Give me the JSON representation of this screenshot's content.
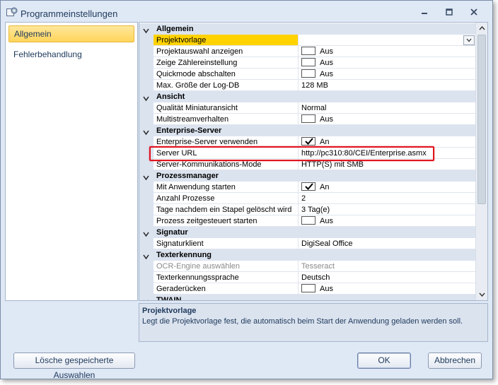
{
  "window": {
    "title": "Programmeinstellungen",
    "icon": "settings-gear-icon"
  },
  "nav": {
    "items": [
      {
        "label": "Allgemein",
        "selected": true
      },
      {
        "label": "Fehlerbehandlung",
        "selected": false
      }
    ]
  },
  "grid": {
    "categories": {
      "allgemein": "Allgemein",
      "ansicht": "Ansicht",
      "enterprise": "Enterprise-Server",
      "prozess": "Prozessmanager",
      "signatur": "Signatur",
      "texterkennung": "Texterkennung",
      "twain": "TWAIN"
    },
    "props": {
      "projektvorlage": {
        "name": "Projektvorlage",
        "value": ""
      },
      "projektauswahl": {
        "name": "Projektauswahl anzeigen",
        "value": "Aus",
        "checked": false
      },
      "zaehler": {
        "name": "Zeige Zählereinstellung",
        "value": "Aus",
        "checked": false
      },
      "quickmode": {
        "name": "Quickmode abschalten",
        "value": "Aus",
        "checked": false
      },
      "logdb": {
        "name": "Max. Größe der Log-DB",
        "value": "128 MB"
      },
      "qualitaet": {
        "name": "Qualität Miniaturansicht",
        "value": "Normal"
      },
      "multistream": {
        "name": "Multistreamverhalten",
        "value": "Aus",
        "checked": false
      },
      "es_verwenden": {
        "name": "Enterprise-Server verwenden",
        "value": "An",
        "checked": true
      },
      "server_url": {
        "name": "Server URL",
        "value": "http://pc310:80/CEI/Enterprise.asmx"
      },
      "kommmode": {
        "name": "Server-Kommunikations-Mode",
        "value": "HTTP(S) mit SMB"
      },
      "mit_anwendung": {
        "name": "Mit Anwendung starten",
        "value": "An",
        "checked": true
      },
      "anzahl": {
        "name": "Anzahl Prozesse",
        "value": "2"
      },
      "tage": {
        "name": "Tage nachdem ein Stapel gelöscht wird",
        "value": "3 Tag(e)"
      },
      "zeitgesteuert": {
        "name": "Prozess zeitgesteuert starten",
        "value": "Aus",
        "checked": false
      },
      "signaturklient": {
        "name": "Signaturklient",
        "value": "DigiSeal Office"
      },
      "ocr_engine": {
        "name": "OCR-Engine auswählen",
        "value": "Tesseract",
        "disabled": true
      },
      "sprache": {
        "name": "Texterkennungssprache",
        "value": "Deutsch"
      },
      "geraderuecken": {
        "name": "Geraderücken",
        "value": "Aus",
        "checked": false
      }
    }
  },
  "description": {
    "title": "Projektvorlage",
    "text": "Legt die Projektvorlage fest, die automatisch beim Start der Anwendung geladen werden soll."
  },
  "buttons": {
    "clear": "Lösche gespeicherte Auswahlen",
    "ok": "OK",
    "cancel": "Abbrechen"
  },
  "colors": {
    "selected_row": "#ffd200",
    "highlight_frame": "#e0121d",
    "window_bg": "#dfe8f5"
  }
}
